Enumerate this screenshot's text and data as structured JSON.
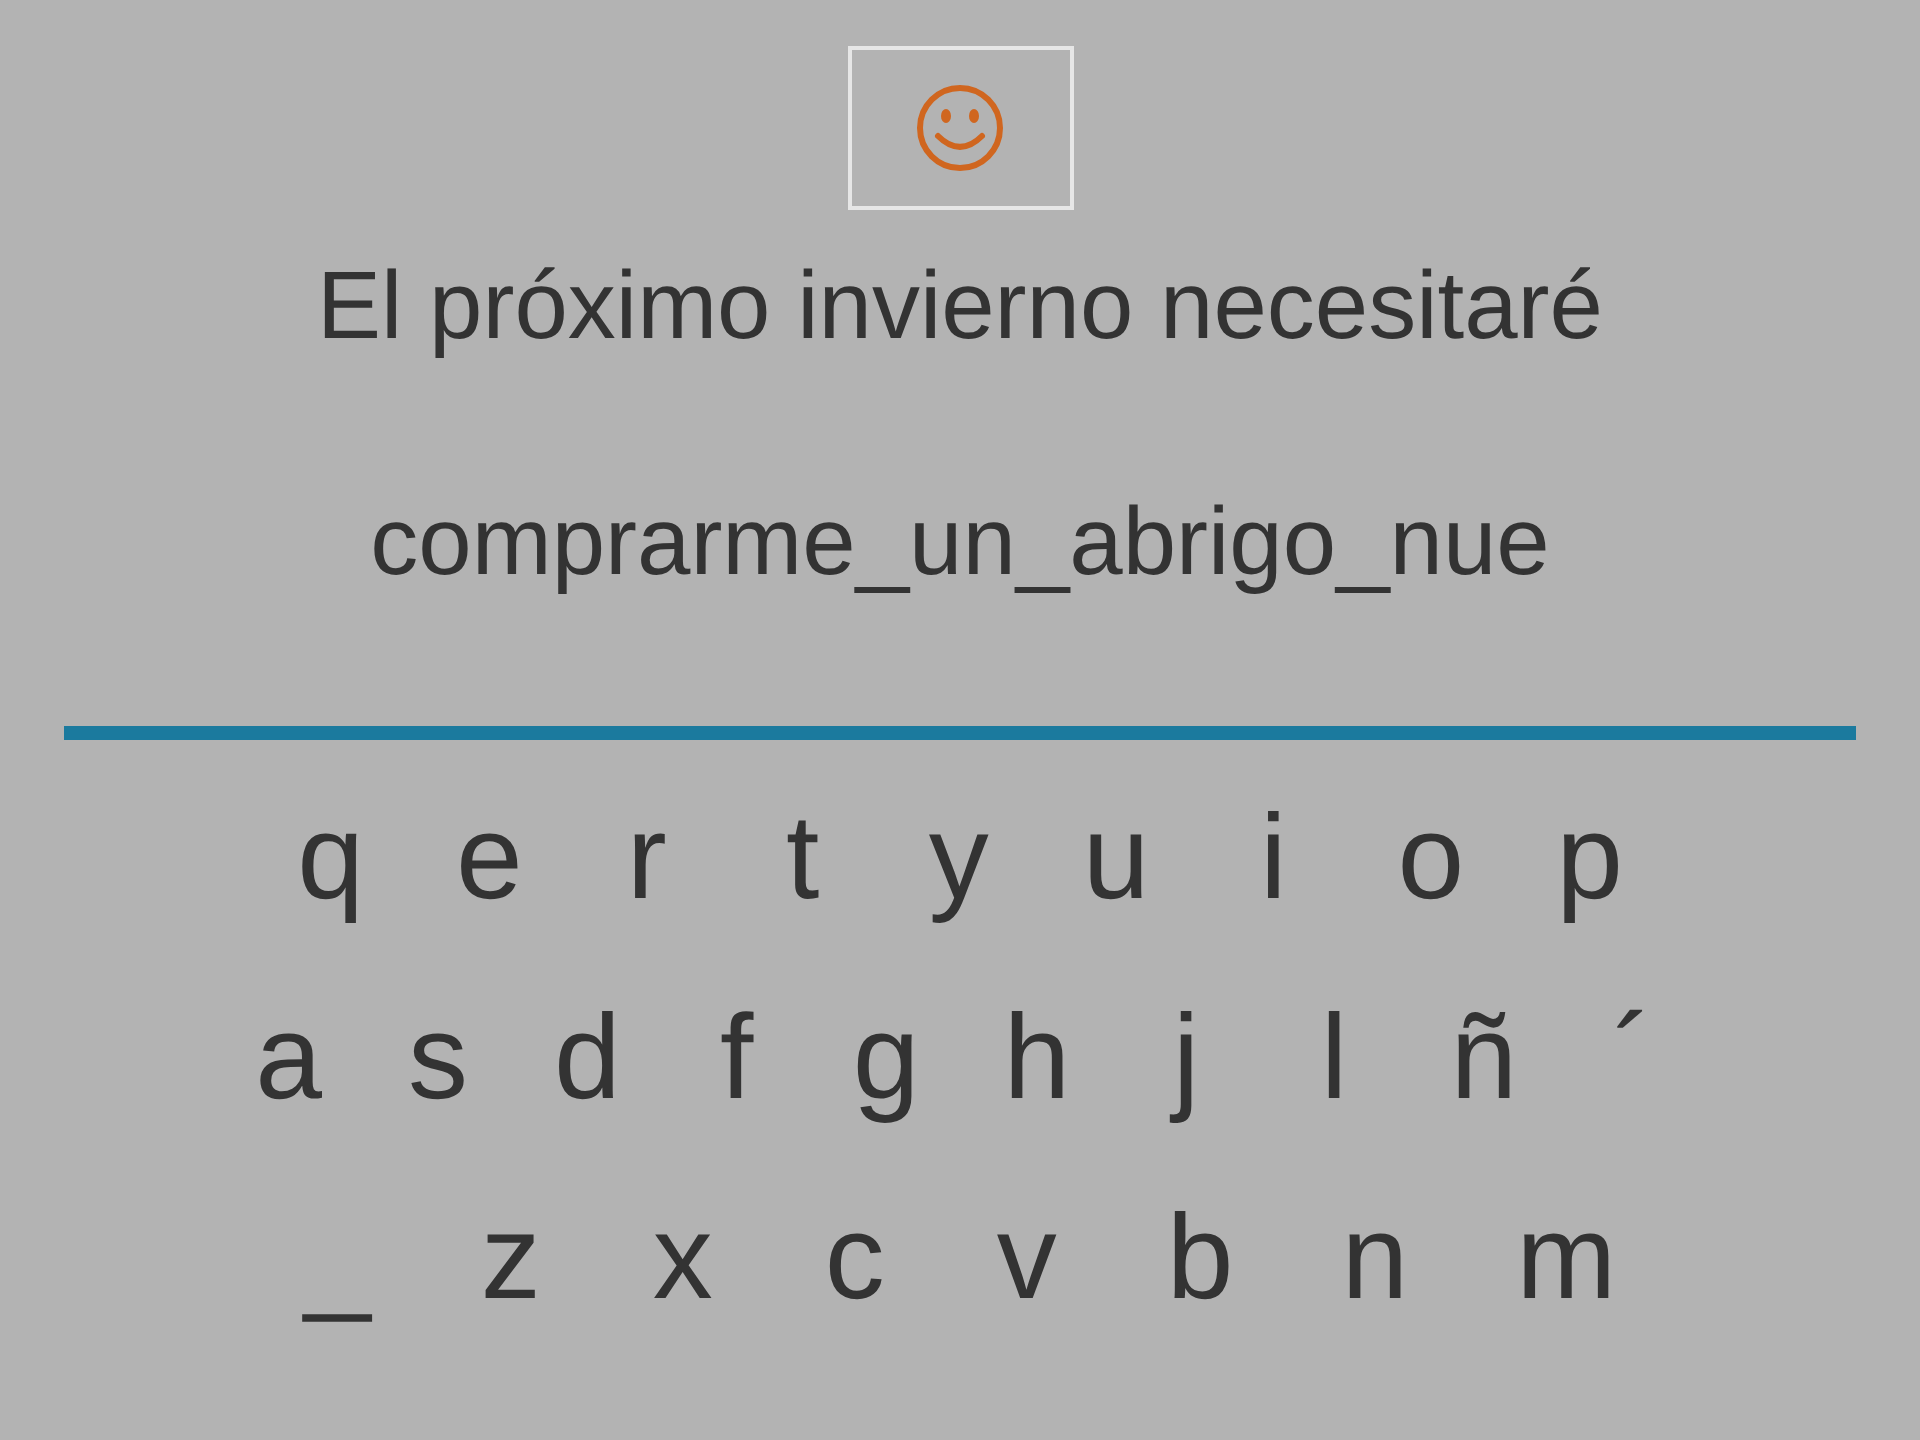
{
  "prompt": {
    "line_1": "El próximo invierno necesitaré",
    "line_2": "comprarme_un_abrigo_nue"
  },
  "keyboard": {
    "rows": [
      [
        "q",
        "e",
        "r",
        "t",
        "y",
        "u",
        "i",
        "o",
        "p"
      ],
      [
        "a",
        "s",
        "d",
        "f",
        "g",
        "h",
        "j",
        "l",
        "ñ",
        "´"
      ],
      [
        "_",
        "z",
        "x",
        "c",
        "v",
        "b",
        "n",
        "m"
      ]
    ]
  }
}
